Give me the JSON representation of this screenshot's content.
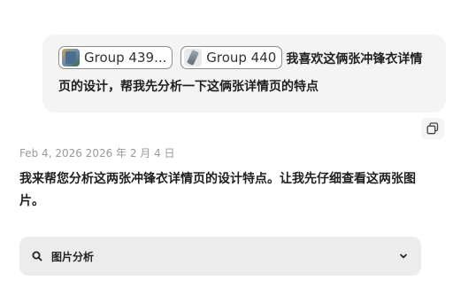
{
  "user_message": {
    "attachments": [
      {
        "name": "Group 439...",
        "thumb_icon": "image-thumbnail-icon"
      },
      {
        "name": "Group 440",
        "thumb_icon": "image-thumbnail-icon"
      }
    ],
    "text": "我喜欢这俩张冲锋衣详情页的设计，帮我先分析一下这俩张详情页的特点"
  },
  "copy_icon": "copy-icon",
  "timestamp": "Feb 4, 2026  2026 年 2 月 4 日",
  "assistant_message": {
    "text": "我来帮您分析这两张冲锋衣详情页的设计特点。让我先仔细查看这两张图片。"
  },
  "analysis_panel": {
    "icon": "search-icon",
    "label": "图片分析",
    "chevron": "chevron-down-icon"
  }
}
